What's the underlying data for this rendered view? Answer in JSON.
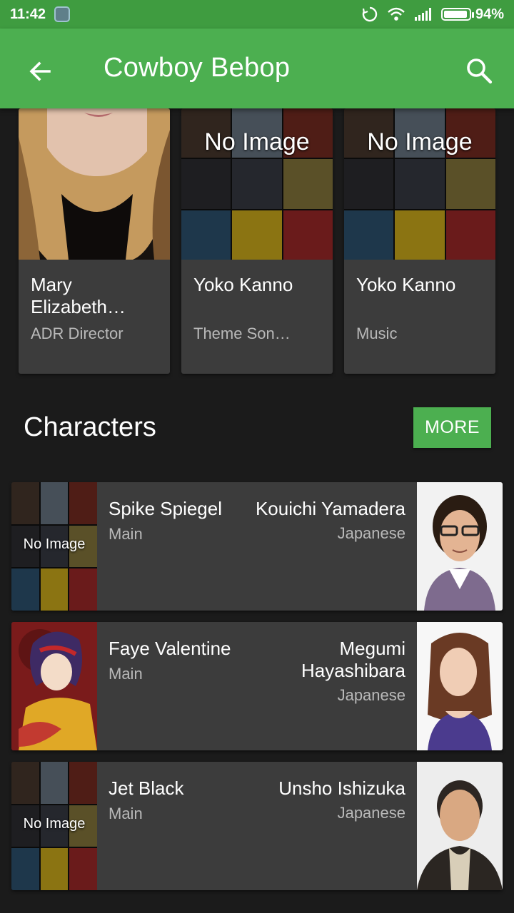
{
  "status_bar": {
    "time": "11:42",
    "battery": "94%",
    "battery_level": 0.94
  },
  "app_bar": {
    "title": "Cowboy Bebop"
  },
  "crew": [
    {
      "name": "Mary Elizabeth…",
      "role": "ADR Director",
      "image": "photo"
    },
    {
      "name": "Yoko Kanno",
      "role": "Theme Son…",
      "image": "no-image",
      "placeholder": "No Image"
    },
    {
      "name": "Yoko Kanno",
      "role": "Music",
      "image": "no-image",
      "placeholder": "No Image"
    }
  ],
  "characters_section": {
    "title": "Characters",
    "more_label": "MORE"
  },
  "characters": [
    {
      "name": "Spike Spiegel",
      "role": "Main",
      "actor": "Kouichi Yamadera",
      "language": "Japanese",
      "char_placeholder": "No Image"
    },
    {
      "name": "Faye Valentine",
      "role": "Main",
      "actor": "Megumi Hayashibara",
      "language": "Japanese"
    },
    {
      "name": "Jet Black",
      "role": "Main",
      "actor": "Unsho Ishizuka",
      "language": "Japanese",
      "char_placeholder": "No Image"
    }
  ]
}
